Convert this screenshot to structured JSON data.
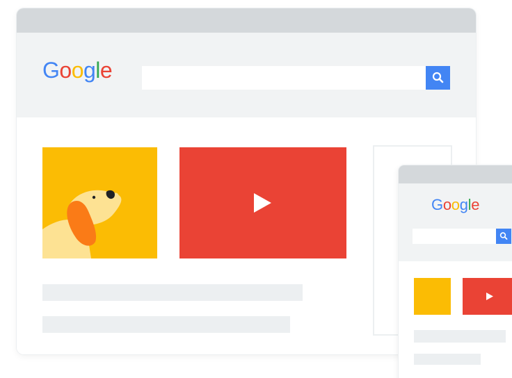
{
  "desktop": {
    "logo": {
      "letters": [
        "G",
        "o",
        "o",
        "g",
        "l",
        "e"
      ],
      "colors": [
        "#4285f4",
        "#ea4335",
        "#fbbc04",
        "#4285f4",
        "#34a853",
        "#ea4335"
      ]
    },
    "search": {
      "value": "",
      "button_icon": "search-icon"
    },
    "ads": [
      {
        "kind": "image",
        "icon": "dog-illustration",
        "color": "#fbbc04"
      },
      {
        "kind": "video",
        "icon": "play-icon",
        "color": "#ea4335"
      }
    ]
  },
  "mobile": {
    "logo": {
      "letters": [
        "G",
        "o",
        "o",
        "g",
        "l",
        "e"
      ],
      "colors": [
        "#4285f4",
        "#ea4335",
        "#fbbc04",
        "#4285f4",
        "#34a853",
        "#ea4335"
      ]
    },
    "search": {
      "value": "",
      "button_icon": "search-icon"
    },
    "ads": [
      {
        "kind": "image",
        "color": "#fbbc04"
      },
      {
        "kind": "video",
        "icon": "play-icon",
        "color": "#ea4335"
      }
    ]
  },
  "colors": {
    "titlebar": "#d4d8db",
    "header": "#f1f3f4",
    "placeholder_line": "#eceff1",
    "search_button": "#4285f4"
  }
}
